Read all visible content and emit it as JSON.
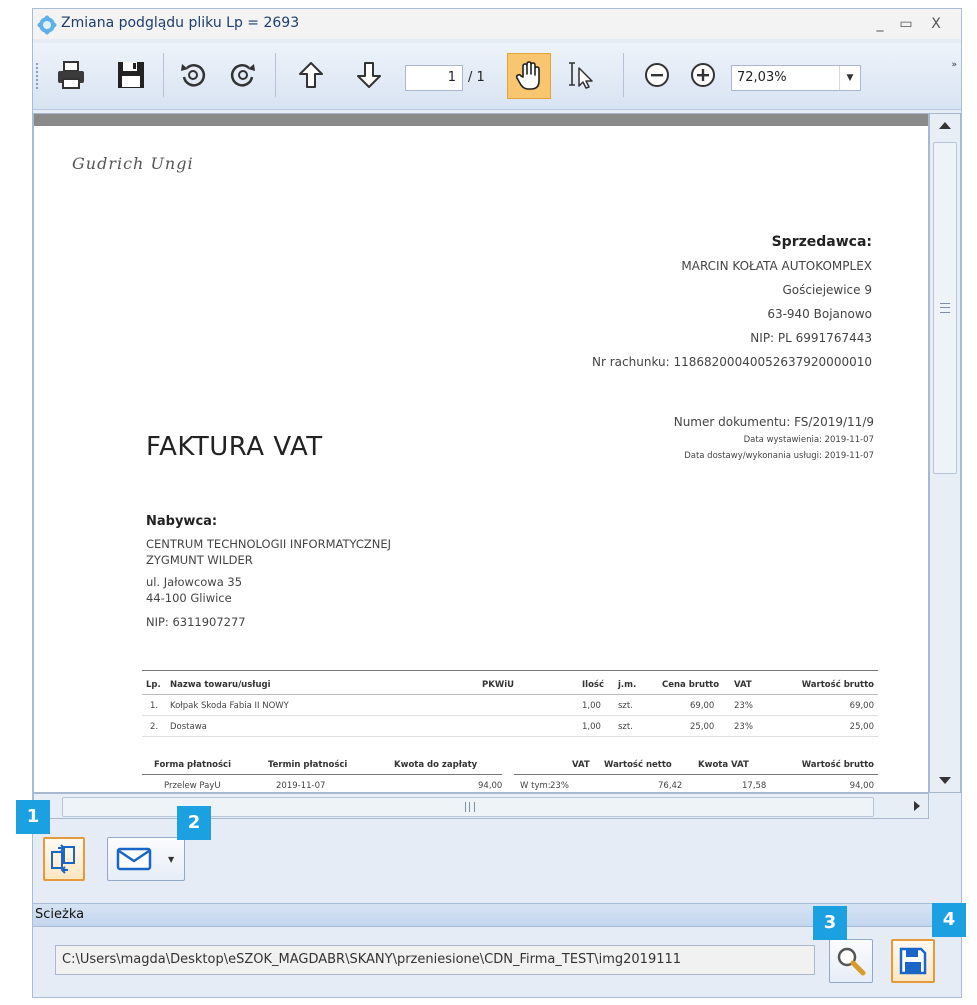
{
  "window": {
    "title": "Zmiana podglądu pliku Lp = 2693",
    "minimize": "_",
    "maximize": "▭",
    "close": "X"
  },
  "toolbar": {
    "page_current": "1",
    "page_total": "/ 1",
    "zoom": "72,03%",
    "more": "»"
  },
  "document": {
    "signature": "Gudrich Ungi",
    "seller": {
      "heading": "Sprzedawca:",
      "name": "MARCIN KOŁATA AUTOKOMPLEX",
      "street": "Gościejewice 9",
      "city": "63-940 Bojanowo",
      "nip": "NIP: PL 6991767443",
      "account": "Nr rachunku: 11868200040052637920000010"
    },
    "doc_number": "Numer dokumentu: FS/2019/11/9",
    "issue_date": "Data wystawienia:   2019-11-07",
    "delivery_date": "Data dostawy/wykonania usługi:   2019-11-07",
    "title": "FAKTURA VAT",
    "buyer": {
      "heading": "Nabywca:",
      "line1": "CENTRUM TECHNOLOGII INFORMATYCZNEJ",
      "line2": "ZYGMUNT WILDER",
      "street": "ul. Jałowcowa 35",
      "city": "44-100 Gliwice",
      "nip": "NIP: 6311907277"
    },
    "items_header": {
      "lp": "Lp.",
      "name": "Nazwa towaru/usługi",
      "pkwiu": "PKWiU",
      "qty": "Ilość",
      "unit": "j.m.",
      "price": "Cena brutto",
      "vat": "VAT",
      "total": "Wartość brutto"
    },
    "items": [
      {
        "lp": "1.",
        "name": "Kołpak Skoda Fabia II NOWY",
        "qty": "1,00",
        "unit": "szt.",
        "price": "69,00",
        "vat": "23%",
        "total": "69,00"
      },
      {
        "lp": "2.",
        "name": "Dostawa",
        "qty": "1,00",
        "unit": "szt.",
        "price": "25,00",
        "vat": "23%",
        "total": "25,00"
      }
    ],
    "payment_header": {
      "form": "Forma płatności",
      "term": "Termin płatności",
      "amount": "Kwota do zapłaty",
      "vat": "VAT",
      "net": "Wartość netto",
      "vat_amount": "Kwota VAT",
      "gross": "Wartość brutto"
    },
    "payment": {
      "form": "Przelew PayU",
      "term": "2019-11-07",
      "amount": "94,00",
      "in_which": "W tym:",
      "vat": "23%",
      "net": "76,42",
      "vat_amount": "17,58",
      "gross": "94,00"
    }
  },
  "badges": [
    "1",
    "2",
    "3",
    "4"
  ],
  "path": {
    "label": "Scieżka",
    "value": "C:\\Users\\magda\\Desktop\\eSZOK_MAGDABR\\SKANY\\przeniesione\\CDN_Firma_TEST\\img2019111"
  },
  "colors": {
    "accent_orange": "#e59a3c",
    "badge_blue": "#1ba1e2",
    "title_blue": "#1e3e6e"
  }
}
